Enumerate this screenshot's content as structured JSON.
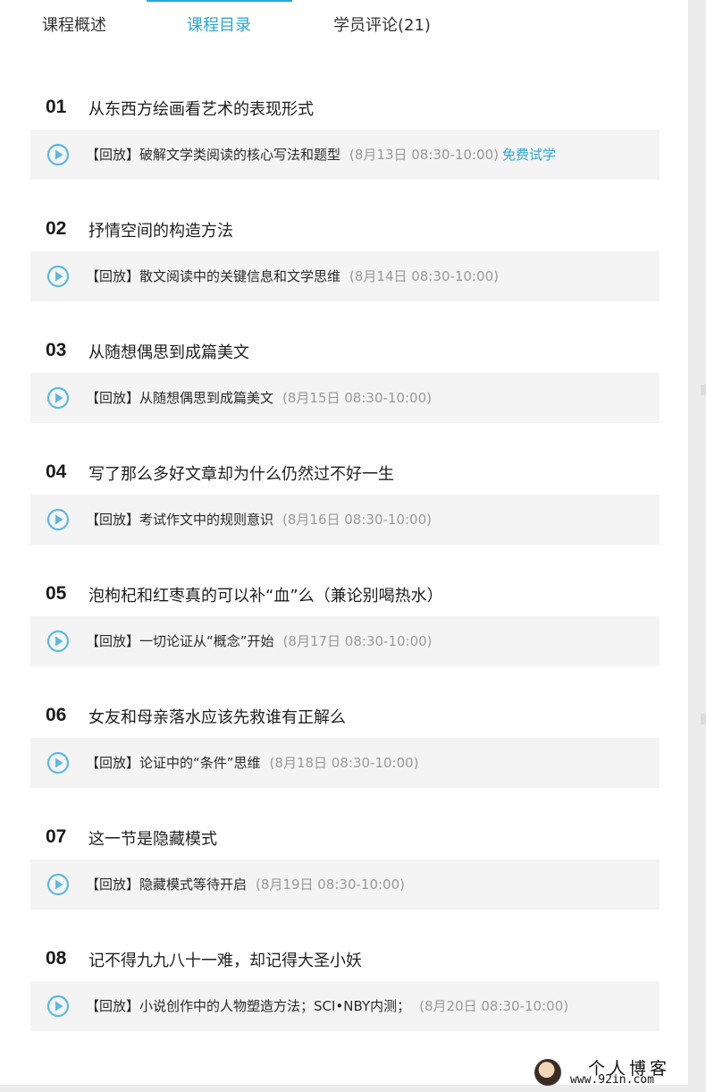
{
  "tabs": [
    {
      "label": "课程概述"
    },
    {
      "label": "课程目录"
    },
    {
      "label": "学员评论(21)"
    }
  ],
  "accent_color": "#2aa7d4",
  "icon": "play-circle-icon",
  "lessons": [
    {
      "num": "01",
      "title": "从东西方绘画看艺术的表现形式",
      "session": {
        "label": "【回放】破解文学类阅读的核心写法和题型",
        "time": "(8月13日 08:30-10:00)",
        "free": "免费试学"
      }
    },
    {
      "num": "02",
      "title": "抒情空间的构造方法",
      "session": {
        "label": "【回放】散文阅读中的关键信息和文学思维",
        "time": "(8月14日 08:30-10:00)"
      }
    },
    {
      "num": "03",
      "title": "从随想偶思到成篇美文",
      "session": {
        "label": "【回放】从随想偶思到成篇美文",
        "time": "(8月15日 08:30-10:00)"
      }
    },
    {
      "num": "04",
      "title": "写了那么多好文章却为什么仍然过不好一生",
      "session": {
        "label": "【回放】考试作文中的规则意识",
        "time": "(8月16日 08:30-10:00)"
      }
    },
    {
      "num": "05",
      "title": "泡枸杞和红枣真的可以补“血”么（兼论别喝热水）",
      "session": {
        "label": "【回放】一切论证从“概念”开始",
        "time": "(8月17日 08:30-10:00)"
      }
    },
    {
      "num": "06",
      "title": "女友和母亲落水应该先救谁有正解么",
      "session": {
        "label": "【回放】论证中的“条件”思维",
        "time": "(8月18日 08:30-10:00)"
      }
    },
    {
      "num": "07",
      "title": "这一节是隐藏模式",
      "session": {
        "label": "【回放】隐藏模式等待开启",
        "time": "(8月19日 08:30-10:00)"
      }
    },
    {
      "num": "08",
      "title": "记不得九九八十一难，却记得大圣小妖",
      "session": {
        "label": "【回放】小说创作中的人物塑造方法；SCI•NBY内测；",
        "time": "(8月20日 08:30-10:00)"
      }
    }
  ],
  "watermark": {
    "title": "个人博客",
    "url": "www.92in.com"
  }
}
